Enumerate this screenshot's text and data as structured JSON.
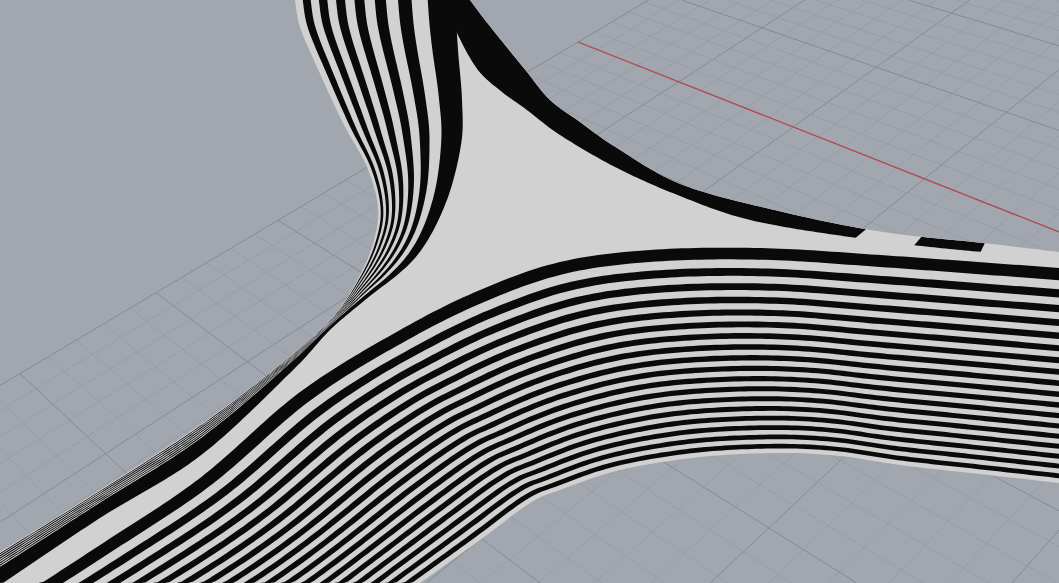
{
  "viewport": {
    "grid": true,
    "x_axis": true
  }
}
